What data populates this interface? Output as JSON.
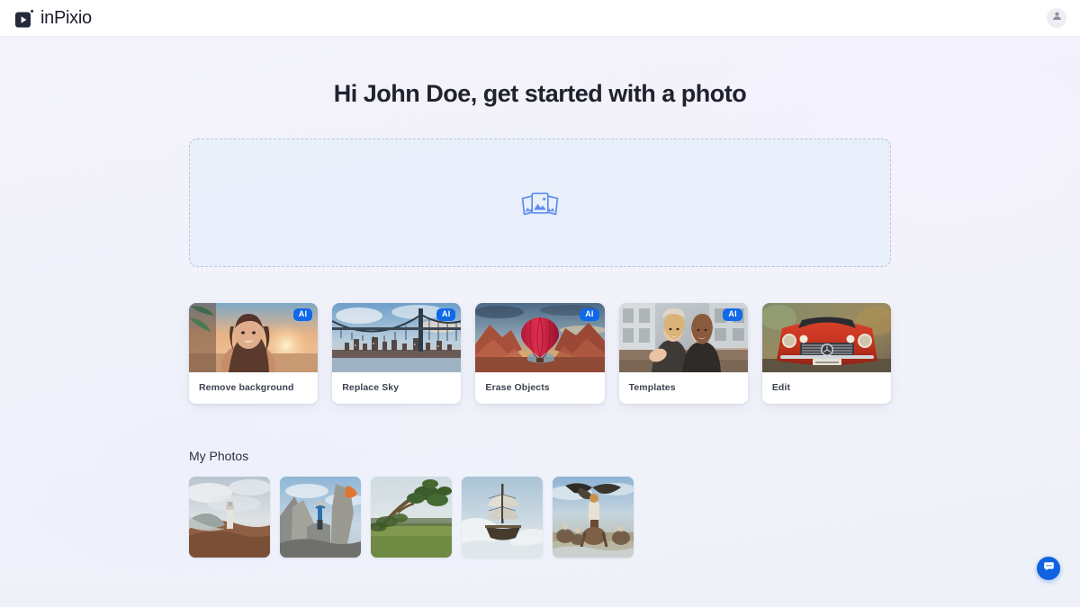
{
  "app": {
    "brand_name": "inPixio",
    "logo_icon": "play-square-icon",
    "accent_color": "#1069e8",
    "background_color": "#f2f2fb"
  },
  "topbar": {
    "account_icon": "user-avatar-icon"
  },
  "main": {
    "title": "Hi John Doe, get started with a photo",
    "dropzone": {
      "icon": "photo-stack-icon"
    },
    "tools": [
      {
        "label": "Remove background",
        "badge": "AI",
        "image_alt": "smiling-woman-beach-sunset"
      },
      {
        "label": "Replace Sky",
        "badge": "AI",
        "image_alt": "suspension-bridge-city-skyline"
      },
      {
        "label": "Erase Objects",
        "badge": "AI",
        "image_alt": "red-hot-air-balloon-canyon"
      },
      {
        "label": "Templates",
        "badge": "AI",
        "image_alt": "two-women-winter-street"
      },
      {
        "label": "Edit",
        "badge": "",
        "image_alt": "red-classic-car"
      }
    ],
    "my_photos": {
      "title": "My Photos",
      "items": [
        {
          "alt": "lighthouse-on-cliff"
        },
        {
          "alt": "person-standing-on-rocks"
        },
        {
          "alt": "windswept-tree-field"
        },
        {
          "alt": "tall-sailing-ship"
        },
        {
          "alt": "eagle-hunters-on-horseback"
        }
      ]
    }
  },
  "support": {
    "chat_icon": "chat-bubble-icon"
  }
}
